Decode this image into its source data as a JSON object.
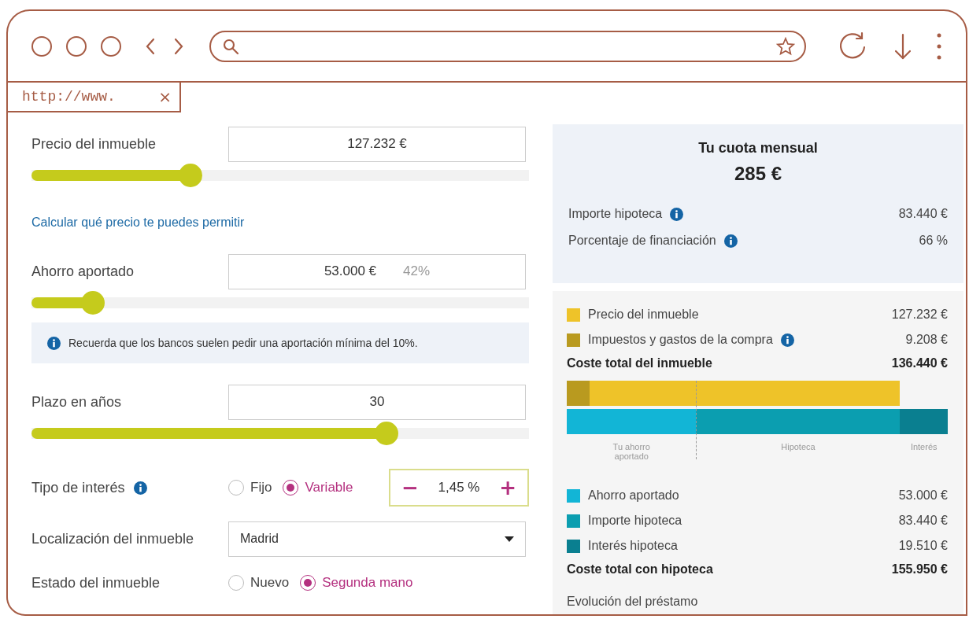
{
  "browser": {
    "tab_url": "http://www.",
    "tab_close": "×"
  },
  "form": [
    {
      "kind": "slider",
      "label": "Precio del inmueble",
      "value": "127.232 €",
      "level": 0.32
    },
    {
      "kind": "link",
      "label": "Calcular qué precio te puedes permitir"
    },
    {
      "kind": "slider",
      "label": "Ahorro aportado",
      "value": "53.000 €",
      "suffix": "42%",
      "level": 0.124
    },
    {
      "kind": "note",
      "label": "Recuerda que los bancos suelen pedir una aportación mínima del 10%."
    },
    {
      "kind": "slider",
      "label": "Plazo en años",
      "value": "30",
      "level": 0.713
    },
    {
      "kind": "rate",
      "label": "Tipo de interés",
      "options": [
        {
          "label": "Fijo",
          "selected": false
        },
        {
          "label": "Variable",
          "selected": true
        }
      ],
      "minus": "−",
      "value": "1,45 %",
      "plus": "+"
    },
    {
      "kind": "select",
      "label": "Localización del inmueble",
      "value": "Madrid"
    },
    {
      "kind": "radio",
      "label": "Estado del inmueble",
      "options": [
        {
          "label": "Nuevo",
          "selected": false
        },
        {
          "label": "Segunda mano",
          "selected": true
        }
      ]
    }
  ],
  "summary": {
    "title": "Tu cuota mensual",
    "amount": "285 €",
    "rows": [
      {
        "label": "Importe hipoteca",
        "info": true,
        "value": "83.440 €"
      },
      {
        "label": "Porcentaje de financiación",
        "info": true,
        "value": "66 %"
      }
    ]
  },
  "breakdown": {
    "items": [
      {
        "label": "Precio del inmueble",
        "color": "#eec329",
        "info": false,
        "value": "127.232 €"
      },
      {
        "label": "Impuestos y gastos de la compra",
        "color": "#b99a1f",
        "info": true,
        "value": "9.208 €"
      }
    ],
    "total": {
      "label": "Coste total del inmueble",
      "value": "136.440 €"
    },
    "bar_labels": [
      "Tu ahorro aportado",
      "Hipoteca",
      "Interés"
    ],
    "loan_items": [
      {
        "label": "Ahorro aportado",
        "color": "#12b5d6",
        "value": "53.000 €"
      },
      {
        "label": "Importe hipoteca",
        "color": "#0b9eb0",
        "value": "83.440 €"
      },
      {
        "label": "Interés hipoteca",
        "color": "#0a7f90",
        "value": "19.510 €"
      }
    ],
    "loan_total": {
      "label": "Coste total con hipoteca",
      "value": "155.950 €"
    },
    "footer": "Evolución del préstamo"
  }
}
